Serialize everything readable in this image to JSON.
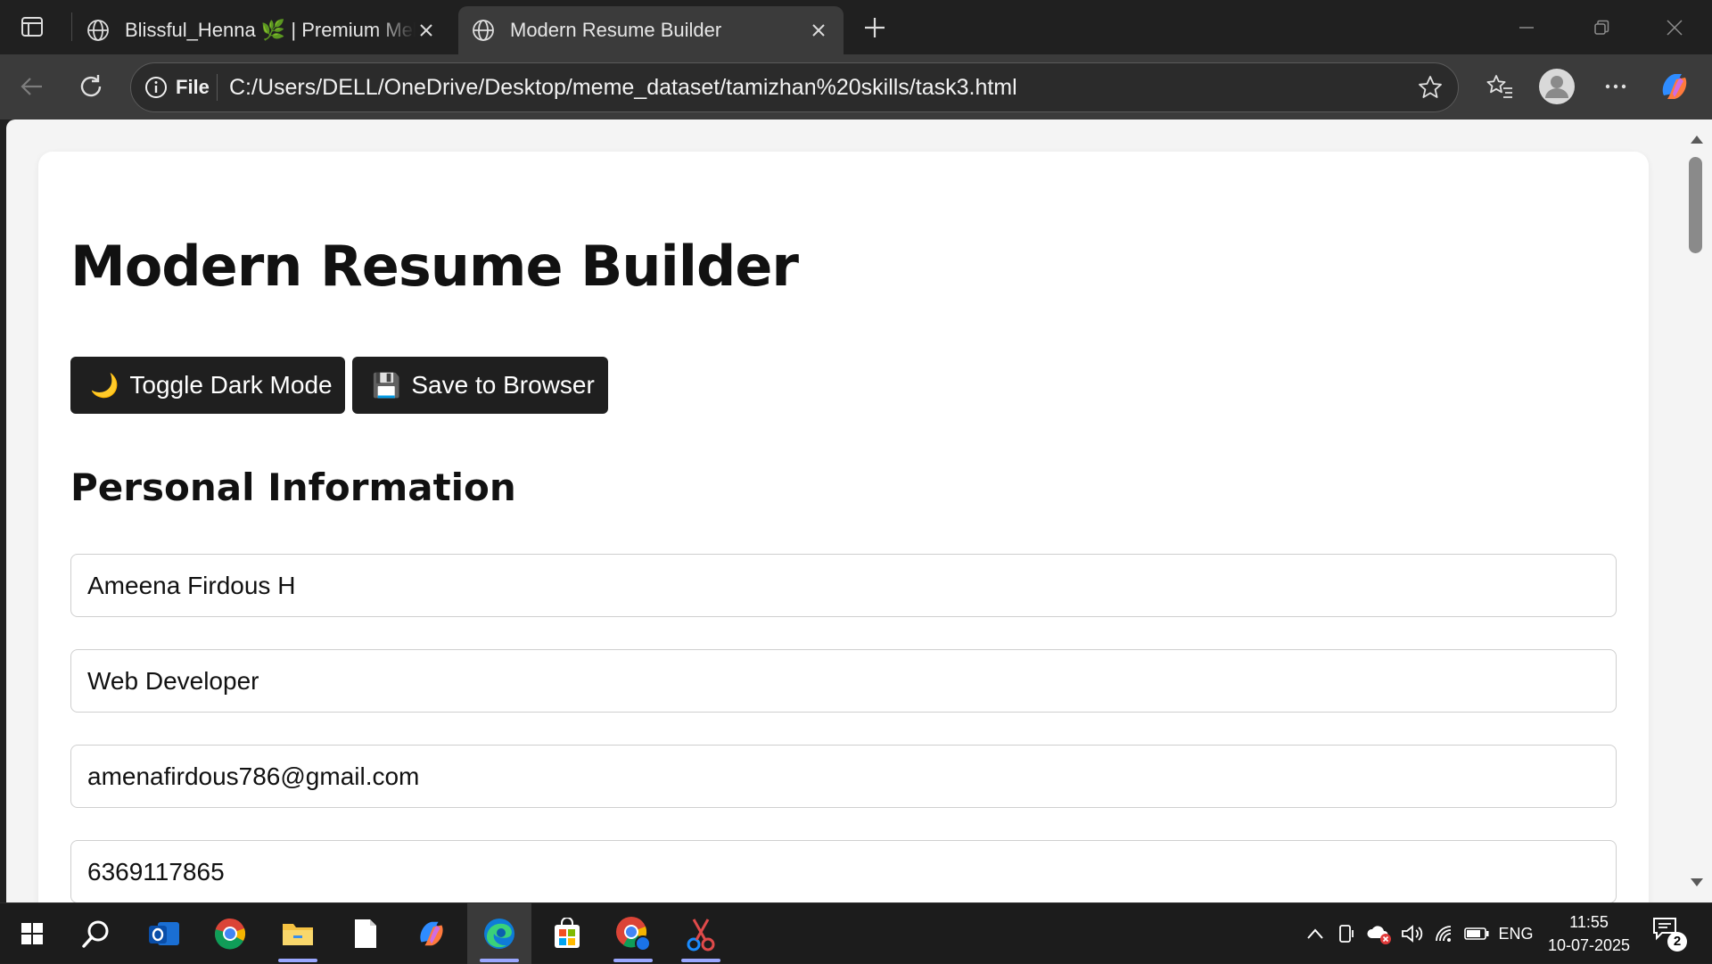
{
  "browser": {
    "tabs": [
      {
        "title": "Blissful_Henna 🌿 | Premium Meh",
        "active": false
      },
      {
        "title": "Modern Resume Builder",
        "active": true
      }
    ],
    "address": {
      "scheme_label": "File",
      "url": "C:/Users/DELL/OneDrive/Desktop/meme_dataset/tamizhan%20skills/task3.html"
    }
  },
  "page": {
    "title": "Modern Resume Builder",
    "buttons": {
      "dark_mode": {
        "emoji": "🌙",
        "label": "Toggle Dark Mode"
      },
      "save": {
        "emoji": "💾",
        "label": "Save to Browser"
      }
    },
    "section_title": "Personal Information",
    "fields": {
      "name": "Ameena Firdous H",
      "role": "Web Developer",
      "email": "amenafirdous786@gmail.com",
      "phone": "6369117865"
    }
  },
  "taskbar": {
    "apps": [
      "start-icon",
      "search-icon",
      "outlook-icon",
      "chrome-icon",
      "file-explorer-icon",
      "notepad-icon",
      "copilot-icon",
      "edge-icon",
      "store-icon",
      "chrome-profile-icon",
      "snipping-tool-icon"
    ],
    "tray": {
      "language": "ENG",
      "time": "11:55",
      "date": "10-07-2025",
      "notification_count": "2"
    }
  },
  "colors": {
    "chrome_bg": "#202020",
    "toolbar_bg": "#3b3b3b",
    "page_bg": "#f4f4f4",
    "button_bg": "#1f1f1f",
    "edge_accent": "#0f7bd8"
  }
}
